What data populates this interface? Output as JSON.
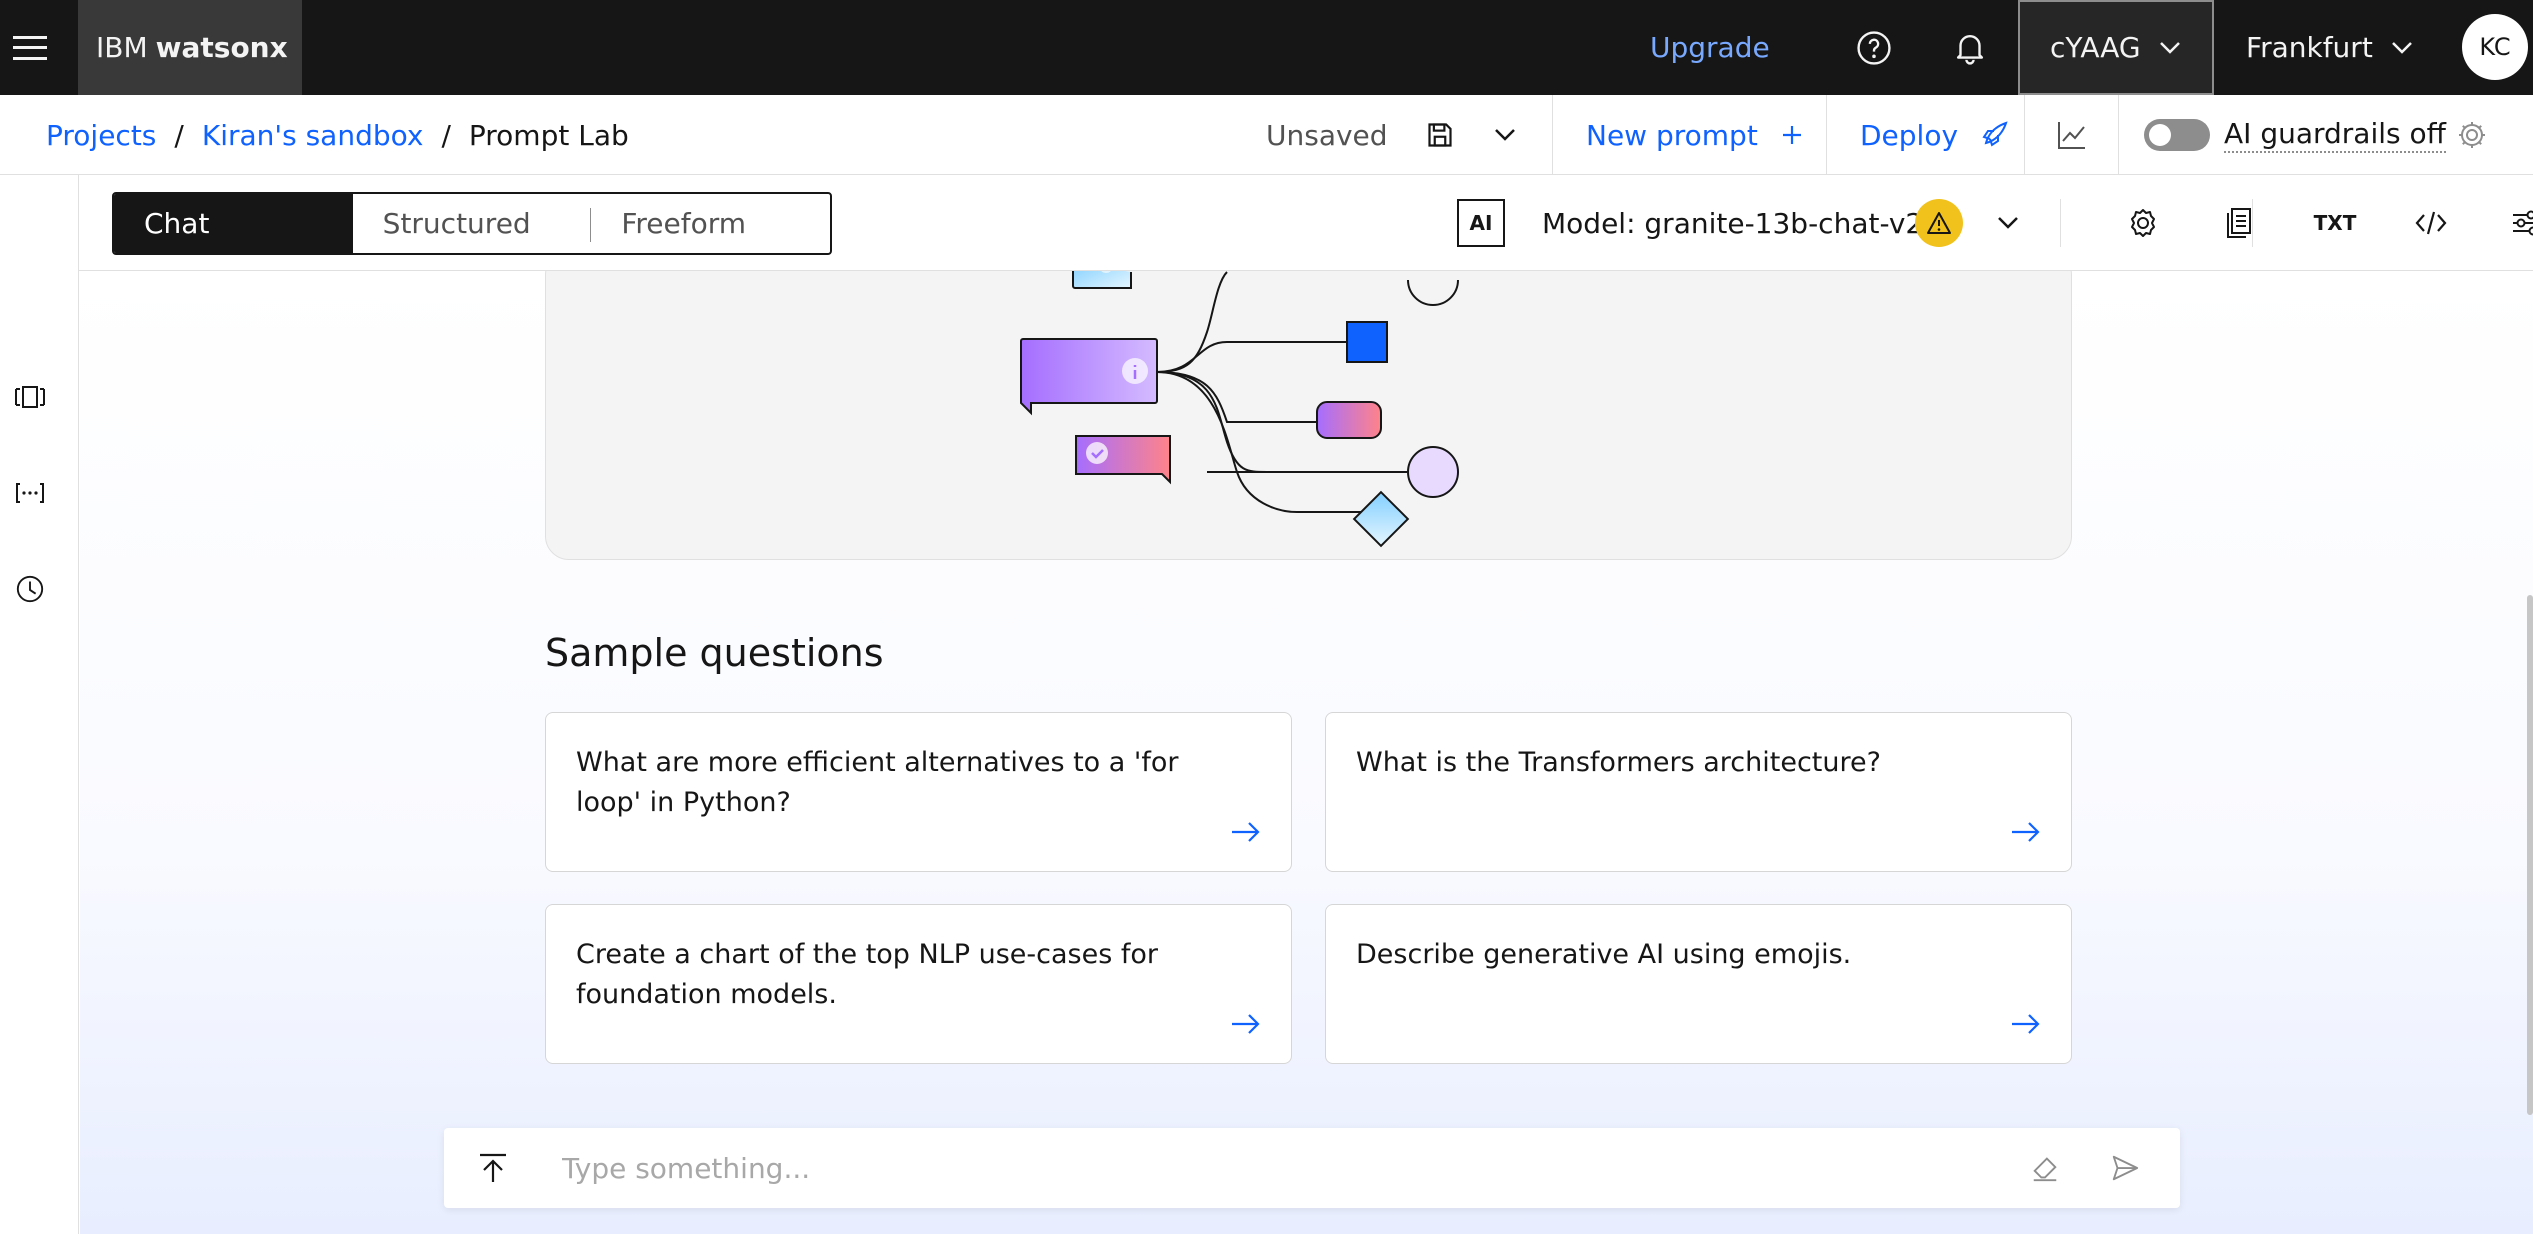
{
  "header": {
    "brand_prefix": "IBM",
    "brand_name": "watsonx",
    "upgrade": "Upgrade",
    "account": "cYAAG",
    "region": "Frankfurt",
    "avatar": "KC"
  },
  "breadcrumb": {
    "items": [
      "Projects",
      "Kiran's sandbox",
      "Prompt Lab"
    ],
    "separator": "/"
  },
  "actions": {
    "status": "Unsaved",
    "new_prompt": "New prompt",
    "deploy": "Deploy",
    "guardrails": "AI guardrails off"
  },
  "toolbar": {
    "modes": [
      "Chat",
      "Structured",
      "Freeform"
    ],
    "active_mode": "Chat",
    "ai_badge": "AI",
    "model": "Model: granite-13b-chat-v2",
    "txt_icon": "TXT"
  },
  "sample_questions": {
    "title": "Sample questions",
    "items": [
      "What are more efficient alternatives to a 'for loop' in Python?",
      "What is the Transformers architecture?",
      "Create a chart of the top NLP use-cases for foundation models.",
      "Describe generative AI using emojis."
    ]
  },
  "chat_input": {
    "placeholder": "Type something..."
  },
  "icons": [
    "menu-icon",
    "help-icon",
    "notification-icon",
    "chevron-down-icon",
    "save-icon",
    "plus-icon",
    "rocket-icon",
    "metrics-icon",
    "gear-icon",
    "sidebar-toggle-icon",
    "variables-icon",
    "history-icon",
    "model-settings-icon",
    "documents-icon",
    "code-icon",
    "sliders-icon",
    "warning-icon",
    "arrow-right-icon",
    "upload-icon",
    "eraser-icon",
    "send-icon"
  ],
  "colors": {
    "header_bg": "#161616",
    "link": "#0f62fe",
    "upgrade": "#78a9ff",
    "warning": "#f1c21b"
  }
}
